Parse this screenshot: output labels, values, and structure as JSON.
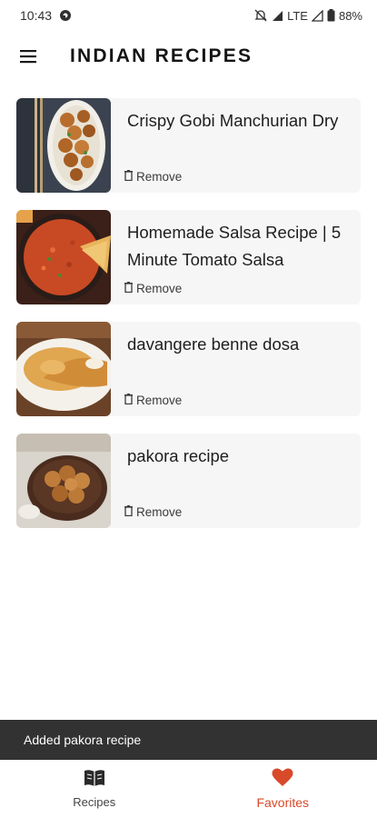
{
  "status_bar": {
    "time": "10:43",
    "network": "LTE",
    "battery": "88%"
  },
  "app_bar": {
    "title": "INDIAN RECIPES",
    "menu_icon": "hamburger-menu-icon"
  },
  "recipes": [
    {
      "title": "Crispy Gobi Manchurian Dry",
      "remove_label": "Remove"
    },
    {
      "title": "Homemade Salsa Recipe | 5 Minute Tomato Salsa",
      "remove_label": "Remove"
    },
    {
      "title": "davangere benne dosa",
      "remove_label": "Remove"
    },
    {
      "title": "pakora recipe",
      "remove_label": "Remove"
    }
  ],
  "snackbar": {
    "message": "Added pakora recipe"
  },
  "bottom_nav": {
    "items": [
      {
        "label": "Recipes",
        "icon": "book-icon",
        "active": false
      },
      {
        "label": "Favorites",
        "icon": "heart-icon",
        "active": true
      }
    ]
  },
  "colors": {
    "accent": "#d84a2a",
    "card_background": "#f6f6f6",
    "snackbar_background": "#323232"
  }
}
